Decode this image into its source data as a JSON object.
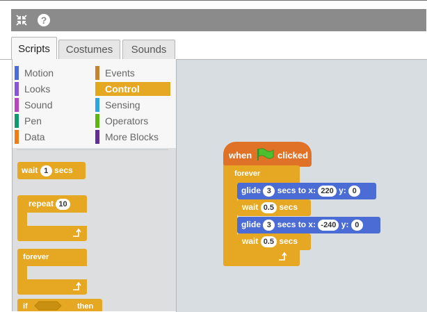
{
  "toolbar": {
    "icons": [
      "shrink-icon",
      "help-icon"
    ]
  },
  "tabs": [
    {
      "label": "Scripts"
    },
    {
      "label": "Costumes"
    },
    {
      "label": "Sounds"
    }
  ],
  "categories": {
    "left": [
      {
        "label": "Motion",
        "color": "#4a6cd4"
      },
      {
        "label": "Looks",
        "color": "#8a55d7"
      },
      {
        "label": "Sound",
        "color": "#bb42c3"
      },
      {
        "label": "Pen",
        "color": "#0e9a6c"
      },
      {
        "label": "Data",
        "color": "#ee7d16"
      }
    ],
    "right": [
      {
        "label": "Events",
        "color": "#c88330"
      },
      {
        "label": "Control",
        "color": "#e1a91a"
      },
      {
        "label": "Sensing",
        "color": "#2ca5e2"
      },
      {
        "label": "Operators",
        "color": "#5cb712"
      },
      {
        "label": "More Blocks",
        "color": "#632d99"
      }
    ]
  },
  "palette_blocks": {
    "wait": {
      "label": "wait",
      "value": "1",
      "unit": "secs"
    },
    "repeat": {
      "label": "repeat",
      "value": "10"
    },
    "forever": {
      "label": "forever"
    },
    "if": {
      "label": "if",
      "then": "then"
    }
  },
  "script": {
    "hat": {
      "when": "when",
      "clicked": "clicked"
    },
    "forever": "forever",
    "glide1": {
      "glide": "glide",
      "secs": "3",
      "secs_to_x": "secs to x:",
      "x": "220",
      "y_label": "y:",
      "y": "0"
    },
    "wait1": {
      "wait": "wait",
      "value": "0.5",
      "unit": "secs"
    },
    "glide2": {
      "glide": "glide",
      "secs": "3",
      "secs_to_x": "secs to x:",
      "x": "-240",
      "y_label": "y:",
      "y": "0"
    },
    "wait2": {
      "wait": "wait",
      "value": "0.5",
      "unit": "secs"
    }
  },
  "colors": {
    "control": "#e6a822",
    "motion": "#4a6cd4",
    "events": "#e07228",
    "flag": "#4cbf2e"
  }
}
